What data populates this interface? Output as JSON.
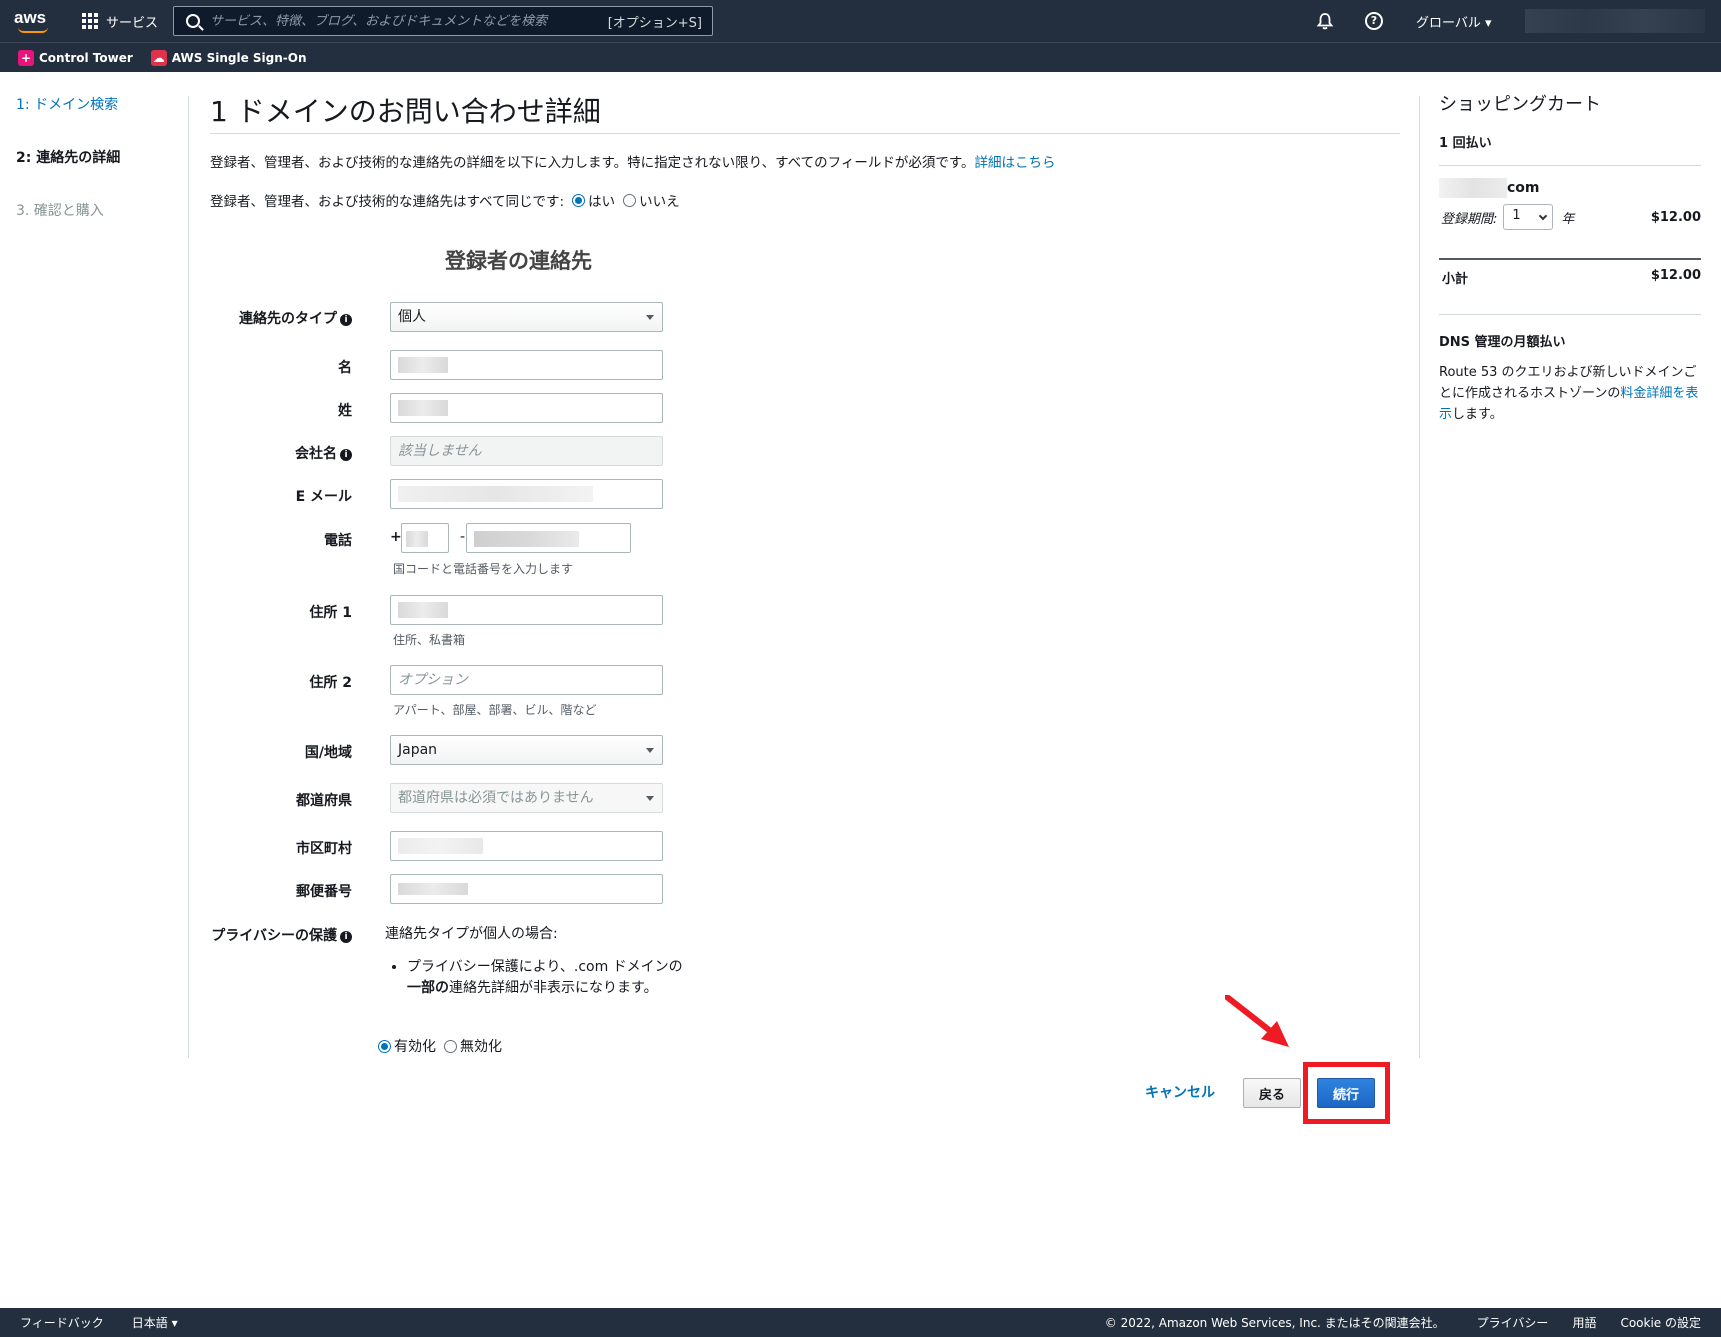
{
  "topbar": {
    "logo": "aws",
    "services_label": "サービス",
    "search_placeholder": "サービス、特徴、ブログ、およびドキュメントなどを検索",
    "search_shortcut": "[オプション+S]",
    "region_label": "グローバル ▾"
  },
  "favorites": [
    {
      "label": "Control Tower",
      "icon": "control-tower-icon",
      "color": "#e7157b"
    },
    {
      "label": "AWS Single Sign-On",
      "icon": "sso-icon",
      "color": "#dd344c"
    }
  ],
  "steps": [
    {
      "label": "1: ドメイン検索",
      "state": "link"
    },
    {
      "label": "2: 連絡先の詳細",
      "state": "current"
    },
    {
      "label": "3. 確認と購入",
      "state": "disabled"
    }
  ],
  "main": {
    "title": "1 ドメインのお問い合わせ詳細",
    "intro": "登録者、管理者、および技術的な連絡先の詳細を以下に入力します。特に指定されない限り、すべてのフィールドが必須です。",
    "intro_link": "詳細はこちら",
    "same_contacts_question": "登録者、管理者、および技術的な連絡先はすべて同じです:",
    "same_yes": "はい",
    "same_no": "いいえ",
    "section_title": "登録者の連絡先"
  },
  "form": {
    "contact_type_label": "連絡先のタイプ",
    "contact_type_value": "個人",
    "first_name_label": "名",
    "last_name_label": "姓",
    "company_label": "会社名",
    "company_placeholder": "該当しません",
    "email_label": "E メール",
    "phone_label": "電話",
    "phone_plus": "+",
    "phone_dash": "-",
    "phone_hint": "国コードと電話番号を入力します",
    "address1_label": "住所 1",
    "address1_hint": "住所、私書箱",
    "address2_label": "住所 2",
    "address2_placeholder": "オプション",
    "address2_hint": "アパート、部屋、部署、ビル、階など",
    "country_label": "国/地域",
    "country_value": "Japan",
    "state_label": "都道府県",
    "state_placeholder": "都道府県は必須ではありません",
    "city_label": "市区町村",
    "zip_label": "郵便番号",
    "privacy_label": "プライバシーの保護",
    "privacy_intro": "連絡先タイプが個人の場合:",
    "privacy_bullet_a": "プライバシー保護により、.com ドメインの",
    "privacy_bullet_bold": "一部の",
    "privacy_bullet_b": "連絡先詳細が非表示になります。",
    "privacy_enable": "有効化",
    "privacy_disable": "無効化"
  },
  "buttons": {
    "cancel": "キャンセル",
    "back": "戻る",
    "continue": "続行"
  },
  "cart": {
    "title": "ショッピングカート",
    "payment_type": "1 回払い",
    "domain_tld": "com",
    "period_label": "登録期間:",
    "period_value": "1",
    "period_unit": "年",
    "item_price": "$12.00",
    "subtotal_label": "小計",
    "subtotal_price": "$12.00",
    "dns_title": "DNS 管理の月額払い",
    "dns_text_a": "Route 53 のクエリおよび新しいドメインごとに作成されるホストゾーンの",
    "dns_link": "料金詳細を表示",
    "dns_text_b": "します。"
  },
  "footer": {
    "feedback": "フィードバック",
    "language": "日本語 ▾",
    "copyright": "© 2022, Amazon Web Services, Inc. またはその関連会社。",
    "privacy": "プライバシー",
    "terms": "用語",
    "cookie": "Cookie の設定"
  },
  "colors": {
    "nav_bg": "#232f3e",
    "link": "#0073bb",
    "primary_button": "#1d66c4",
    "annotation_red": "#ee1b24"
  }
}
